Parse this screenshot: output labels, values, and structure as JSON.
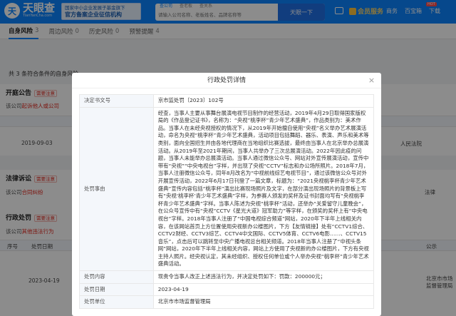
{
  "header": {
    "logo_mark": "天",
    "logo_name": "天眼查",
    "logo_url": "TianYanCha.com",
    "gov_badge_line1": "国家中小企业发展子基金旗下",
    "gov_badge_line2": "官方备案企业征信机构",
    "search_tabs": [
      "查公司",
      "查老板",
      "查关系"
    ],
    "search_placeholder": "请输入公司名称、老板姓名、品牌名称等",
    "search_button": "天眼一下",
    "member_label": "会员服务",
    "links": [
      "商务",
      "百宝箱",
      "下载"
    ],
    "hot_badge": "HOT"
  },
  "page_tabs": [
    {
      "label": "自身风险",
      "count": "3",
      "active": true
    },
    {
      "label": "周边风险",
      "count": "0",
      "active": false
    },
    {
      "label": "历史风险",
      "count": "0",
      "active": false
    },
    {
      "label": "预警提醒",
      "count": "4",
      "active": false
    }
  ],
  "background": {
    "summary": "共 3 条符合条件的自身风险",
    "sections": [
      {
        "title": "开庭公告",
        "tag": "需要注意",
        "desc_prefix": "该公司",
        "desc_red": "起诉他人或公司",
        "row_date": "2019-09-03"
      },
      {
        "title": "法律诉讼",
        "tag": "需要注意",
        "desc_prefix": "该公司",
        "desc_red": "合同纠纷"
      },
      {
        "title": "行政处罚",
        "tag": "需要注意",
        "desc_prefix": "该公司",
        "desc_red": "其他违法行为",
        "col_no": "序号",
        "col_date": "处罚日期",
        "row_date": "2023-04-19",
        "right_org": "北京市市场监督管理局"
      }
    ],
    "right_col_label": "公示",
    "right_texts": [
      "人民法院",
      "法律",
      "北京市"
    ]
  },
  "modal": {
    "title": "行政处罚详情",
    "close": "×",
    "rows": [
      {
        "label": "决定书文号",
        "value": "京市监处罚〔2023〕102号"
      },
      {
        "label": "处罚事由",
        "value": "经查，当事人主要从事舞台展演电视节目制作的经营活动，2019年4月29日取得国家版权局的《作品登记证书》，名称为：“央视”桃李杯”青少年艺术盛典”，作品类别为：美术作品。当事人在未经央视授权的情况下，从2019年开始擅自使用“央视”名义举办艺术展演活动，命名为央视“桃李杯”青少年艺术盛典，活动项目包括舞蹈、器乐、表演、声乐和美术等类别，面向全国招生并由各地代理商在当地组织比赛选拔，最终由当事人在北京举办总展演活动。从2019年至2021年期间，当事人共举办了三次总展演活动。2022年因此疫的问题，当事人未能举办总展演活动。当事人通过微信公众号、网站对外宣传展演活动，宣传中带有“央视”“中央电视台”字样，并出现了央视“CCTV”标志和办公场所照片。2018年7月，当事人注册微信公众号，同年8月改名为“中视前线综艺电视节目”，通过该微信公众号对外开展宣传活动，2022年6月17日刊登了一篇文章，标题为：“2021央视桃李杯青少年艺术盛典”宣传内容包括“桃李杯”演出比赛现场照片及文字，在部分演出现场照片的背景板上写有“央视‘桃李杯’青少年艺术盛典”字样，为参赛人颁发的奖杯及证书封面均写有“央视桃李杯青少年艺术盛典”字样。当事人陈述为央视“桃李杯”活动，还举办“关爱留守儿童晚会”，在公众号宣传中有“央视”CCTV《星光大道》冠军助力”等字样，在颁奖的奖杯上有“中央电视台”字样。2018年当事人注册了“中国电视综合频道”网站，2020年下半年上线相关内容，在该网站首页上方位置使用央视新办公楼图片，下方【友情链接】处有“CCTV1综合、CCTV2财经、CCTV3综艺、CCTV4中文国际、CCTV5体育、CCTV6电影……、CCTV15音乐”，点击后可以跳转至中央广播电视总台相关频道。2018年当事人注册了“中视头条网”网站，2020年下半年上线相关内容，网站上方使用了央视新的办公楼图片，下方有央视主持人照片。经央视认定，其未经组织、授权任何单位或个人举办央视“桃李杯”青少年艺术盛典活动。"
      },
      {
        "label": "处罚内容",
        "value": "现责令当事人改正上述违法行为，并决定处罚如下：罚款：200000元；"
      },
      {
        "label": "处罚日期",
        "value": "2023-04-19"
      },
      {
        "label": "处罚单位",
        "value": "北京市市场监督管理局"
      }
    ]
  }
}
